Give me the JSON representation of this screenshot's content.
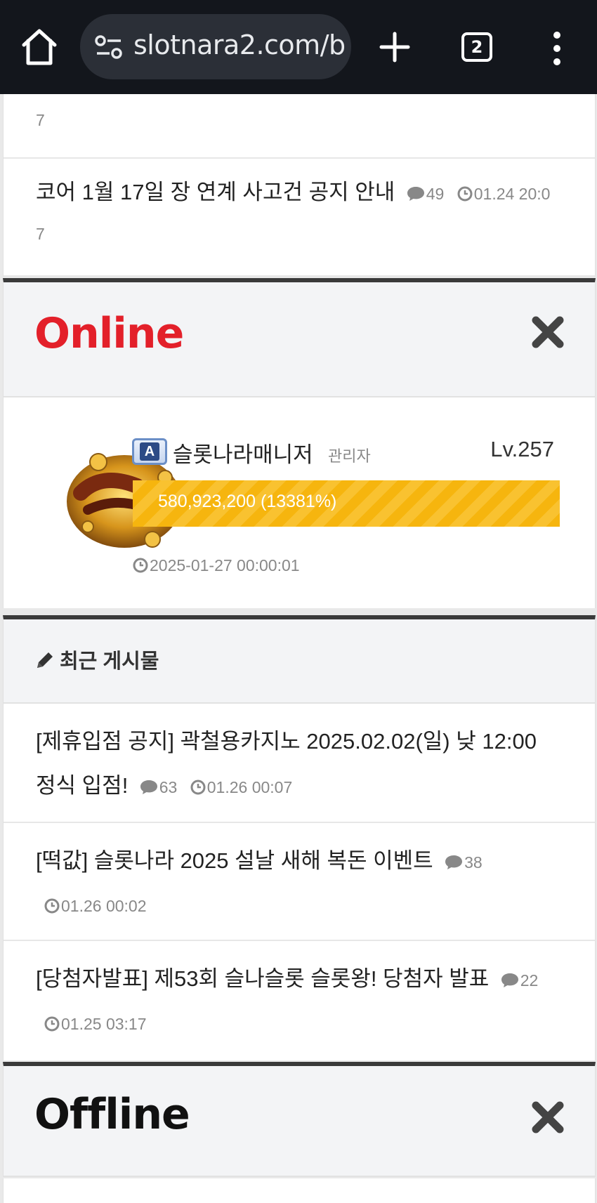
{
  "browser": {
    "url": "slotnara2.com/b",
    "tab_count": "2"
  },
  "notices_tail": {
    "first_row_tail": "7",
    "item": {
      "title": "코어 1월 17일 장 연계 사고건 공지 안내",
      "comments": "49",
      "time": "01.24 20:0",
      "time_wrap": "7"
    }
  },
  "online": {
    "title": "Online",
    "user": {
      "name": "슬롯나라매니저",
      "role": "관리자",
      "level": "Lv.257",
      "exp_text": "580,923,200 (13381%)",
      "last_seen": "2025-01-27 00:00:01"
    }
  },
  "recent": {
    "title": "최근 게시물",
    "items": [
      {
        "title": "[제휴입점 공지] 곽철용카지노 2025.02.02(일) 낮 12:00 정식 입점!",
        "comments": "63",
        "time": "01.26 00:07"
      },
      {
        "title": "[떡값] 슬롯나라 2025 설날 새해 복돈 이벤트",
        "comments": "38",
        "time": "01.26 00:02"
      },
      {
        "title": "[당첨자발표] 제53회 슬나슬롯 슬롯왕! 당첨자 발표",
        "comments": "22",
        "time": "01.25 03:17"
      }
    ]
  },
  "offline": {
    "title": "Offline"
  },
  "colors": {
    "online_title": "#e3202a",
    "xp_bar": "#f6b50e",
    "section_border": "#3a3a3a"
  }
}
